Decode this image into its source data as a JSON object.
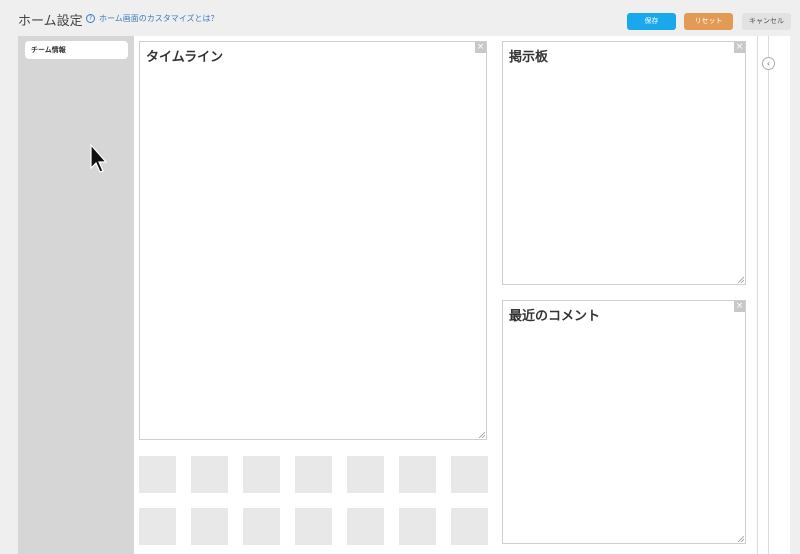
{
  "header": {
    "title": "ホーム設定",
    "help_link": "ホーム画面のカスタマイズとは？",
    "help_icon": "?",
    "save_label": "保存",
    "reset_label": "リセット",
    "cancel_label": "キャンセル"
  },
  "sidebar": {
    "items": [
      {
        "label": "チーム情報"
      }
    ]
  },
  "panels": {
    "timeline": {
      "title": "タイムライン"
    },
    "board": {
      "title": "掲示板"
    },
    "comments": {
      "title": "最近のコメント"
    },
    "close_glyph": "×"
  },
  "collapse_glyph": "‹",
  "colors": {
    "save": "#1aa8ec",
    "reset": "#e39a55",
    "cancel": "#e2e2e2",
    "sidebar": "#d6d6d6",
    "link": "#3a7bbf"
  }
}
